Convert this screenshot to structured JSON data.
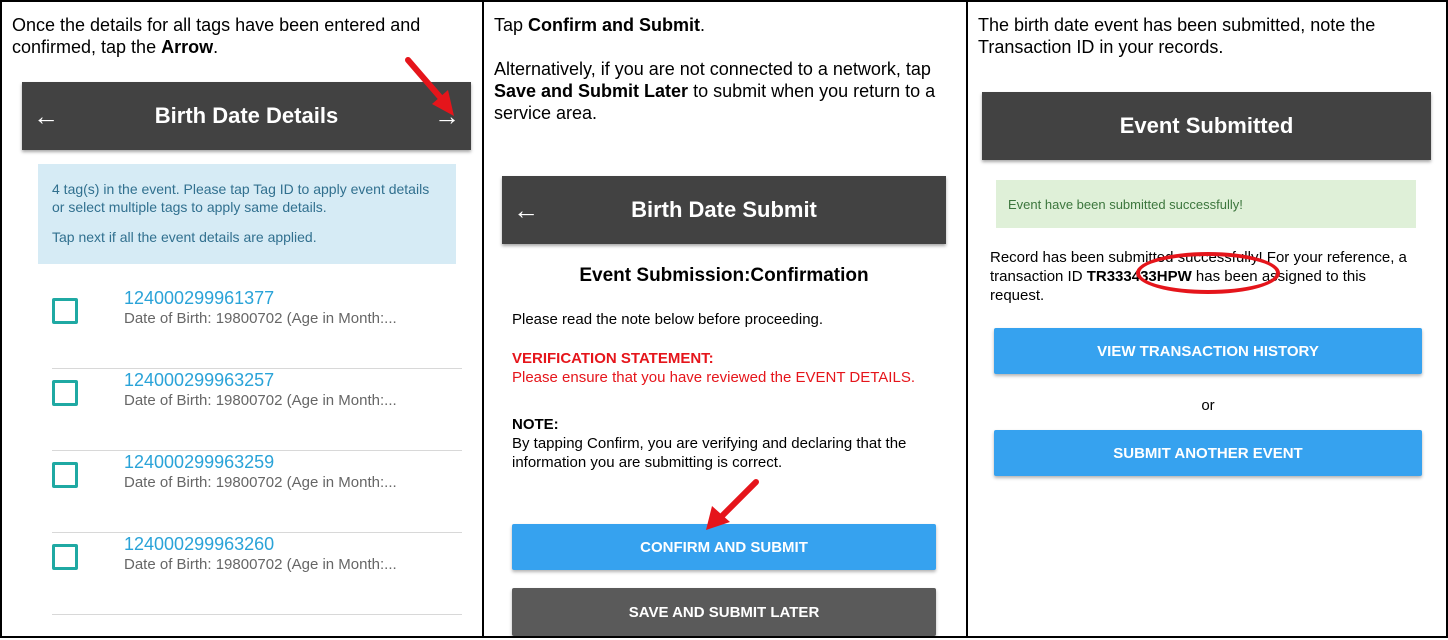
{
  "panel1": {
    "instruction_prefix": "Once the details for all tags have been entered and confirmed, tap the ",
    "instruction_bold": "Arrow",
    "instruction_suffix": ".",
    "appbar": {
      "back_icon": "←",
      "title": "Birth Date Details",
      "forward_icon": "→"
    },
    "info": {
      "line1": "4 tag(s) in the event. Please tap Tag ID to apply event details or select multiple tags to apply same details.",
      "line2": "Tap next if all the event details are applied."
    },
    "tags": [
      {
        "id": "124000299961377",
        "detail": "Date of Birth: 19800702 (Age in Month:..."
      },
      {
        "id": "124000299963257",
        "detail": "Date of Birth: 19800702 (Age in Month:..."
      },
      {
        "id": "124000299963259",
        "detail": "Date of Birth: 19800702 (Age in Month:..."
      },
      {
        "id": "124000299963260",
        "detail": "Date of Birth: 19800702 (Age in Month:..."
      }
    ]
  },
  "panel2": {
    "instruction1_prefix": "Tap ",
    "instruction1_bold": "Confirm and Submit",
    "instruction1_suffix": ".",
    "instruction2_prefix": "Alternatively, if you are not connected to a network, tap ",
    "instruction2_bold": "Save and Submit Later",
    "instruction2_suffix": " to submit when you return to a service area.",
    "appbar": {
      "back_icon": "←",
      "title": "Birth Date Submit"
    },
    "heading": "Event Submission:Confirmation",
    "note_intro": "Please read the note below before proceeding.",
    "verification_title": "VERIFICATION STATEMENT:",
    "verification_text": "Please ensure that you have reviewed the EVENT DETAILS.",
    "note_title": "NOTE:",
    "note_text": "By tapping Confirm, you are verifying and declaring that the information you are submitting is correct.",
    "confirm_button": "CONFIRM AND SUBMIT",
    "save_button": "SAVE AND SUBMIT LATER"
  },
  "panel3": {
    "instruction": "The birth date event has been submitted, note the Transaction ID in your records.",
    "appbar": {
      "title": "Event Submitted"
    },
    "success": "Event have been submitted successfully!",
    "record_prefix": "Record has been submitted successfully! For your reference, a transaction ID ",
    "transaction_id": "TR333433HPW",
    "record_suffix": " has been assigned to this request.",
    "view_history_button": "VIEW TRANSACTION HISTORY",
    "or_text": "or",
    "submit_another_button": "SUBMIT ANOTHER EVENT"
  },
  "colors": {
    "appbar": "#424242",
    "accent_blue": "#36a2ef",
    "tag_link": "#2aa3d8",
    "checkbox": "#1fa9a3",
    "annotation_red": "#e5151b"
  }
}
